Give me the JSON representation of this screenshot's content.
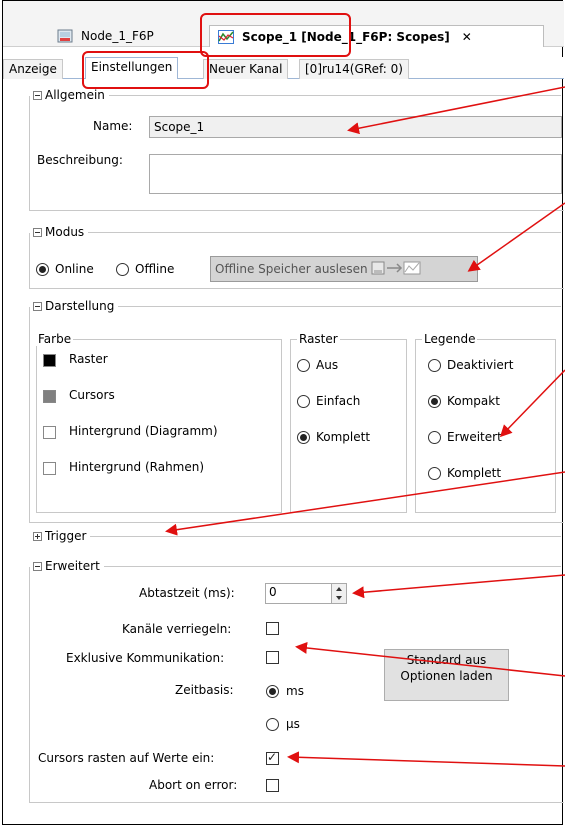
{
  "document_tabs": [
    {
      "label": "Node_1_F6P"
    },
    {
      "label": "Scope_1 [Node_1_F6P: Scopes]",
      "close": "✕"
    }
  ],
  "sub_tabs": [
    "Anzeige",
    "Einstellungen",
    "Neuer Kanal",
    "[0]ru14(GRef: 0)"
  ],
  "allgemein": {
    "header": "Allgemein",
    "name_label": "Name:",
    "name_value": "Scope_1",
    "beschreibung_label": "Beschreibung:"
  },
  "modus": {
    "header": "Modus",
    "online": "Online",
    "offline": "Offline",
    "read_button": "Offline Speicher auslesen"
  },
  "darstellung": {
    "header": "Darstellung",
    "farbe": {
      "title": "Farbe",
      "items": [
        "Raster",
        "Cursors",
        "Hintergrund (Diagramm)",
        "Hintergrund (Rahmen)"
      ],
      "colors": [
        "#000000",
        "#808080",
        "#ffffff",
        "#ffffff"
      ]
    },
    "raster": {
      "title": "Raster",
      "options": [
        "Aus",
        "Einfach",
        "Komplett"
      ],
      "selected": "Komplett"
    },
    "legende": {
      "title": "Legende",
      "options": [
        "Deaktiviert",
        "Kompakt",
        "Erweitert",
        "Komplett"
      ],
      "selected": "Kompakt"
    }
  },
  "trigger": {
    "header": "Trigger"
  },
  "erweitert": {
    "header": "Erweitert",
    "abtastzeit_label": "Abtastzeit (ms):",
    "abtastzeit_value": "0",
    "kanaele_label": "Kanäle verriegeln:",
    "exklusiv_label": "Exklusive Kommunikation:",
    "zeitbasis_label": "Zeitbasis:",
    "zeitbasis_ms": "ms",
    "zeitbasis_us": "μs",
    "cursors_label": "Cursors rasten auf Werte ein:",
    "abort_label": "Abort on error:",
    "standard_button": "Standard aus Optionen laden"
  },
  "colors": {
    "annotation": "#e01010",
    "tab_border": "#9fb7d6"
  }
}
